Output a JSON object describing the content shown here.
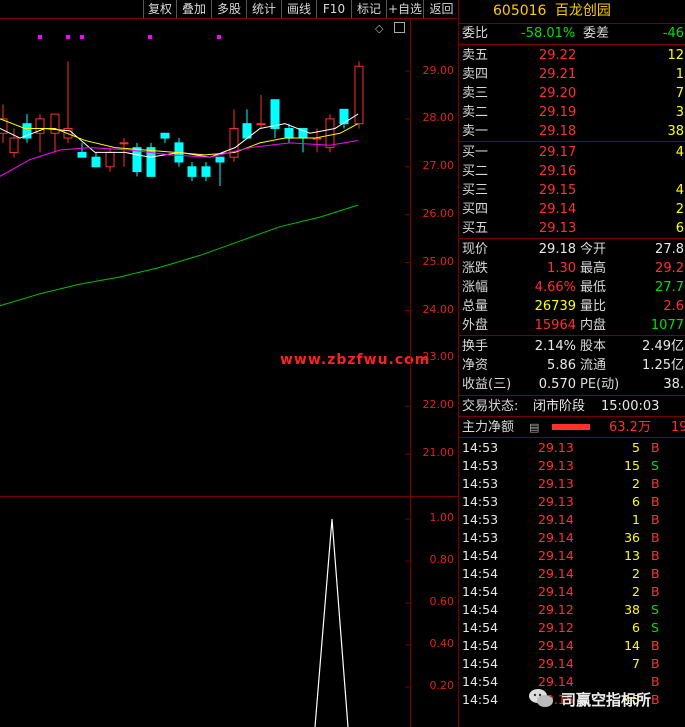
{
  "toolbar": {
    "buttons": [
      "复权",
      "叠加",
      "多股",
      "统计",
      "画线",
      "F10",
      "标记",
      "+自选",
      "返回"
    ]
  },
  "price_axis": [
    "29.00",
    "28.00",
    "27.00",
    "26.00",
    "25.00",
    "24.00",
    "23.00",
    "22.00",
    "21.00"
  ],
  "indicator_axis": [
    "1.00",
    "0.80",
    "0.60",
    "0.40",
    "0.20"
  ],
  "watermark": "www.zbzfwu.com",
  "stock": {
    "code": "605016",
    "name": "百龙创园"
  },
  "weibi": {
    "label1": "委比",
    "value1": "-58.01%",
    "label2": "委差",
    "value2": "-46"
  },
  "sell": [
    {
      "label": "卖五",
      "price": "29.22",
      "vol": "12"
    },
    {
      "label": "卖四",
      "price": "29.21",
      "vol": "1"
    },
    {
      "label": "卖三",
      "price": "29.20",
      "vol": "7"
    },
    {
      "label": "卖二",
      "price": "29.19",
      "vol": "3"
    },
    {
      "label": "卖一",
      "price": "29.18",
      "vol": "38"
    }
  ],
  "buy": [
    {
      "label": "买一",
      "price": "29.17",
      "vol": "4"
    },
    {
      "label": "买二",
      "price": "29.16",
      "vol": ""
    },
    {
      "label": "买三",
      "price": "29.15",
      "vol": "4"
    },
    {
      "label": "买四",
      "price": "29.14",
      "vol": "2"
    },
    {
      "label": "买五",
      "price": "29.13",
      "vol": "6"
    }
  ],
  "quote": [
    {
      "l1": "现价",
      "v1": "29.18",
      "c1": "white",
      "l2": "今开",
      "v2": "27.8",
      "c2": "white"
    },
    {
      "l1": "涨跌",
      "v1": "1.30",
      "c1": "red",
      "l2": "最高",
      "v2": "29.2",
      "c2": "red"
    },
    {
      "l1": "涨幅",
      "v1": "4.66%",
      "c1": "red",
      "l2": "最低",
      "v2": "27.7",
      "c2": "green"
    },
    {
      "l1": "总量",
      "v1": "26739",
      "c1": "yellow",
      "l2": "量比",
      "v2": "2.6",
      "c2": "red"
    },
    {
      "l1": "外盘",
      "v1": "15964",
      "c1": "red",
      "l2": "内盘",
      "v2": "1077",
      "c2": "green"
    }
  ],
  "fundamentals": [
    {
      "l1": "换手",
      "v1": "2.14%",
      "l2": "股本",
      "v2": "2.49亿"
    },
    {
      "l1": "净资",
      "v1": "5.86",
      "l2": "流通",
      "v2": "1.25亿"
    },
    {
      "l1": "收益(三)",
      "v1": "0.570",
      "l2": "PE(动)",
      "v2": "38."
    }
  ],
  "status": {
    "label": "交易状态:",
    "value": "闭市阶段",
    "time": "15:00:03"
  },
  "main_flow": {
    "label": "主力净额",
    "value": "63.2万",
    "extra": "19"
  },
  "ticks": [
    {
      "t": "14:53",
      "p": "29.13",
      "v": "5",
      "s": "B"
    },
    {
      "t": "14:53",
      "p": "29.13",
      "v": "15",
      "s": "S"
    },
    {
      "t": "14:53",
      "p": "29.13",
      "v": "2",
      "s": "B"
    },
    {
      "t": "14:53",
      "p": "29.13",
      "v": "6",
      "s": "B"
    },
    {
      "t": "14:53",
      "p": "29.14",
      "v": "1",
      "s": "B"
    },
    {
      "t": "14:53",
      "p": "29.14",
      "v": "36",
      "s": "B"
    },
    {
      "t": "14:54",
      "p": "29.14",
      "v": "13",
      "s": "B"
    },
    {
      "t": "14:54",
      "p": "29.14",
      "v": "2",
      "s": "B"
    },
    {
      "t": "14:54",
      "p": "29.14",
      "v": "2",
      "s": "B"
    },
    {
      "t": "14:54",
      "p": "29.12",
      "v": "38",
      "s": "S"
    },
    {
      "t": "14:54",
      "p": "29.12",
      "v": "6",
      "s": "S"
    },
    {
      "t": "14:54",
      "p": "29.14",
      "v": "14",
      "s": "B"
    },
    {
      "t": "14:54",
      "p": "29.14",
      "v": "7",
      "s": "B"
    },
    {
      "t": "14:54",
      "p": "29.14",
      "v": "",
      "s": "B"
    },
    {
      "t": "14:54",
      "p": "29.15",
      "v": "15",
      "s": "B"
    }
  ],
  "brand": "司赢空指标所",
  "colors": {
    "up": "#ff3030",
    "down": "#00ffff",
    "ma5": "#ffffff",
    "ma10": "#ffff00",
    "ma20": "#ff00ff",
    "ma60": "#00c000"
  }
}
